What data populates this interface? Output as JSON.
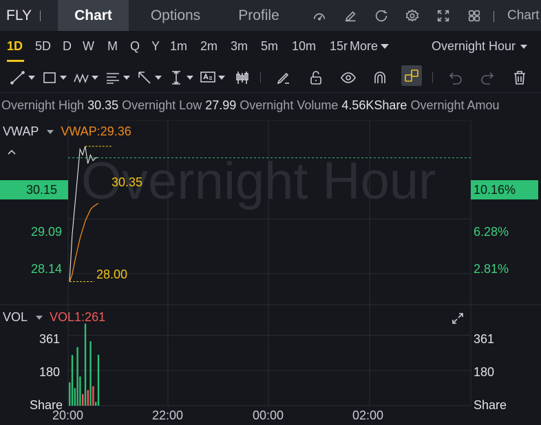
{
  "header": {
    "ticker": "FLY",
    "tabs": [
      {
        "label": "Chart",
        "active": true
      },
      {
        "label": "Options",
        "active": false
      },
      {
        "label": "Profile",
        "active": false
      }
    ],
    "right_label": "Chart"
  },
  "intervals": {
    "items": [
      "1D",
      "5D",
      "D",
      "W",
      "M",
      "Q",
      "Y",
      "1m",
      "2m",
      "3m",
      "5m",
      "10m",
      "15r",
      "More"
    ],
    "active": "1D",
    "session": "Overnight Hour"
  },
  "info": {
    "high_label": "Overnight High",
    "high": "30.35",
    "low_label": "Overnight Low",
    "low": "27.99",
    "volume_label": "Overnight Volume",
    "volume": "4.56KShare",
    "amount_label": "Overnight Amou"
  },
  "indicators": {
    "main_name": "VWAP",
    "main_value": "VWAP:29.36",
    "sub_name": "VOL",
    "sub_value": "VOL1:261"
  },
  "chart": {
    "watermark": "Overnight Hour",
    "price_tag": "30.15",
    "pct_tag": "10.16%",
    "high_marker": "30.35",
    "low_marker": "28.00",
    "y_left": [
      "29.09",
      "28.14"
    ],
    "y_right": [
      "6.28%",
      "2.81%"
    ],
    "vol_ticks": [
      "361",
      "180",
      "Share"
    ],
    "x_ticks": [
      "20:00",
      "22:00",
      "00:00",
      "02:00"
    ]
  },
  "colors": {
    "up": "#2dbf74",
    "down": "#f25a5a",
    "vwap": "#f0891a",
    "accent": "#f5c518",
    "price_line": "#e6e6e6"
  },
  "chart_data": {
    "type": "line",
    "x_ticks": [
      "20:00",
      "22:00",
      "00:00",
      "02:00"
    ],
    "series": [
      {
        "name": "VWAP",
        "values": [
          28.0,
          28.12,
          28.35,
          28.55,
          28.75,
          28.9,
          29.05,
          29.15,
          29.25,
          29.3,
          29.33,
          29.36
        ]
      }
    ],
    "price_values": [
      28.0,
      28.8,
      29.3,
      29.8,
      30.3,
      30.2,
      30.35,
      30.05,
      30.2,
      30.1,
      30.15,
      30.15
    ],
    "volume_values": [
      120,
      260,
      90,
      300,
      150,
      60,
      420,
      80,
      330,
      100,
      20,
      261
    ],
    "ylim": [
      27.6,
      30.8
    ],
    "vol_ylim": [
      0,
      440
    ]
  }
}
